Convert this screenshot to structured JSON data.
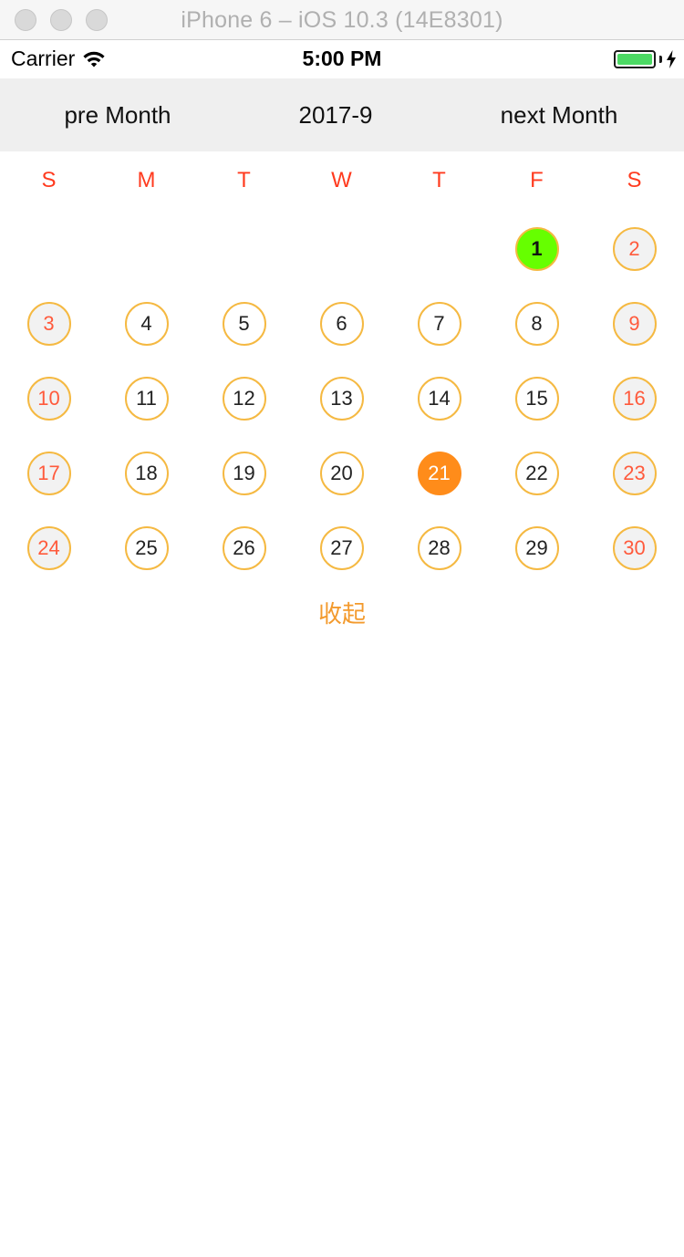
{
  "window": {
    "title": "iPhone 6 – iOS 10.3 (14E8301)"
  },
  "status_bar": {
    "carrier": "Carrier",
    "time": "5:00 PM",
    "battery_level": 1.0,
    "icons": [
      "wifi-icon",
      "battery-icon",
      "charging-bolt-icon"
    ]
  },
  "calendar": {
    "prev_label": "pre Month",
    "title": "2017-9",
    "next_label": "next Month",
    "weekdays": [
      "S",
      "M",
      "T",
      "W",
      "T",
      "F",
      "S"
    ],
    "weeks": [
      [
        {
          "day": "",
          "state": "empty"
        },
        {
          "day": "",
          "state": "empty"
        },
        {
          "day": "",
          "state": "empty"
        },
        {
          "day": "",
          "state": "empty"
        },
        {
          "day": "",
          "state": "empty"
        },
        {
          "day": "1",
          "state": "selected"
        },
        {
          "day": "2",
          "state": "weekend"
        }
      ],
      [
        {
          "day": "3",
          "state": "weekend"
        },
        {
          "day": "4",
          "state": "normal"
        },
        {
          "day": "5",
          "state": "normal"
        },
        {
          "day": "6",
          "state": "normal"
        },
        {
          "day": "7",
          "state": "normal"
        },
        {
          "day": "8",
          "state": "normal"
        },
        {
          "day": "9",
          "state": "weekend"
        }
      ],
      [
        {
          "day": "10",
          "state": "weekend"
        },
        {
          "day": "11",
          "state": "normal"
        },
        {
          "day": "12",
          "state": "normal"
        },
        {
          "day": "13",
          "state": "normal"
        },
        {
          "day": "14",
          "state": "normal"
        },
        {
          "day": "15",
          "state": "normal"
        },
        {
          "day": "16",
          "state": "weekend"
        }
      ],
      [
        {
          "day": "17",
          "state": "weekend"
        },
        {
          "day": "18",
          "state": "normal"
        },
        {
          "day": "19",
          "state": "normal"
        },
        {
          "day": "20",
          "state": "normal"
        },
        {
          "day": "21",
          "state": "today"
        },
        {
          "day": "22",
          "state": "normal"
        },
        {
          "day": "23",
          "state": "weekend"
        }
      ],
      [
        {
          "day": "24",
          "state": "weekend"
        },
        {
          "day": "25",
          "state": "normal"
        },
        {
          "day": "26",
          "state": "normal"
        },
        {
          "day": "27",
          "state": "normal"
        },
        {
          "day": "28",
          "state": "normal"
        },
        {
          "day": "29",
          "state": "normal"
        },
        {
          "day": "30",
          "state": "weekend"
        }
      ]
    ],
    "collapse_label": "收起"
  },
  "colors": {
    "weekday_text": "#ff3b1f",
    "weekend_text": "#ff5a3c",
    "circle_border": "#f5b942",
    "today_fill": "#ff8c1a",
    "selected_fill": "#66ff00",
    "header_bg": "#efefef",
    "collapse_text": "#f39a2d"
  }
}
